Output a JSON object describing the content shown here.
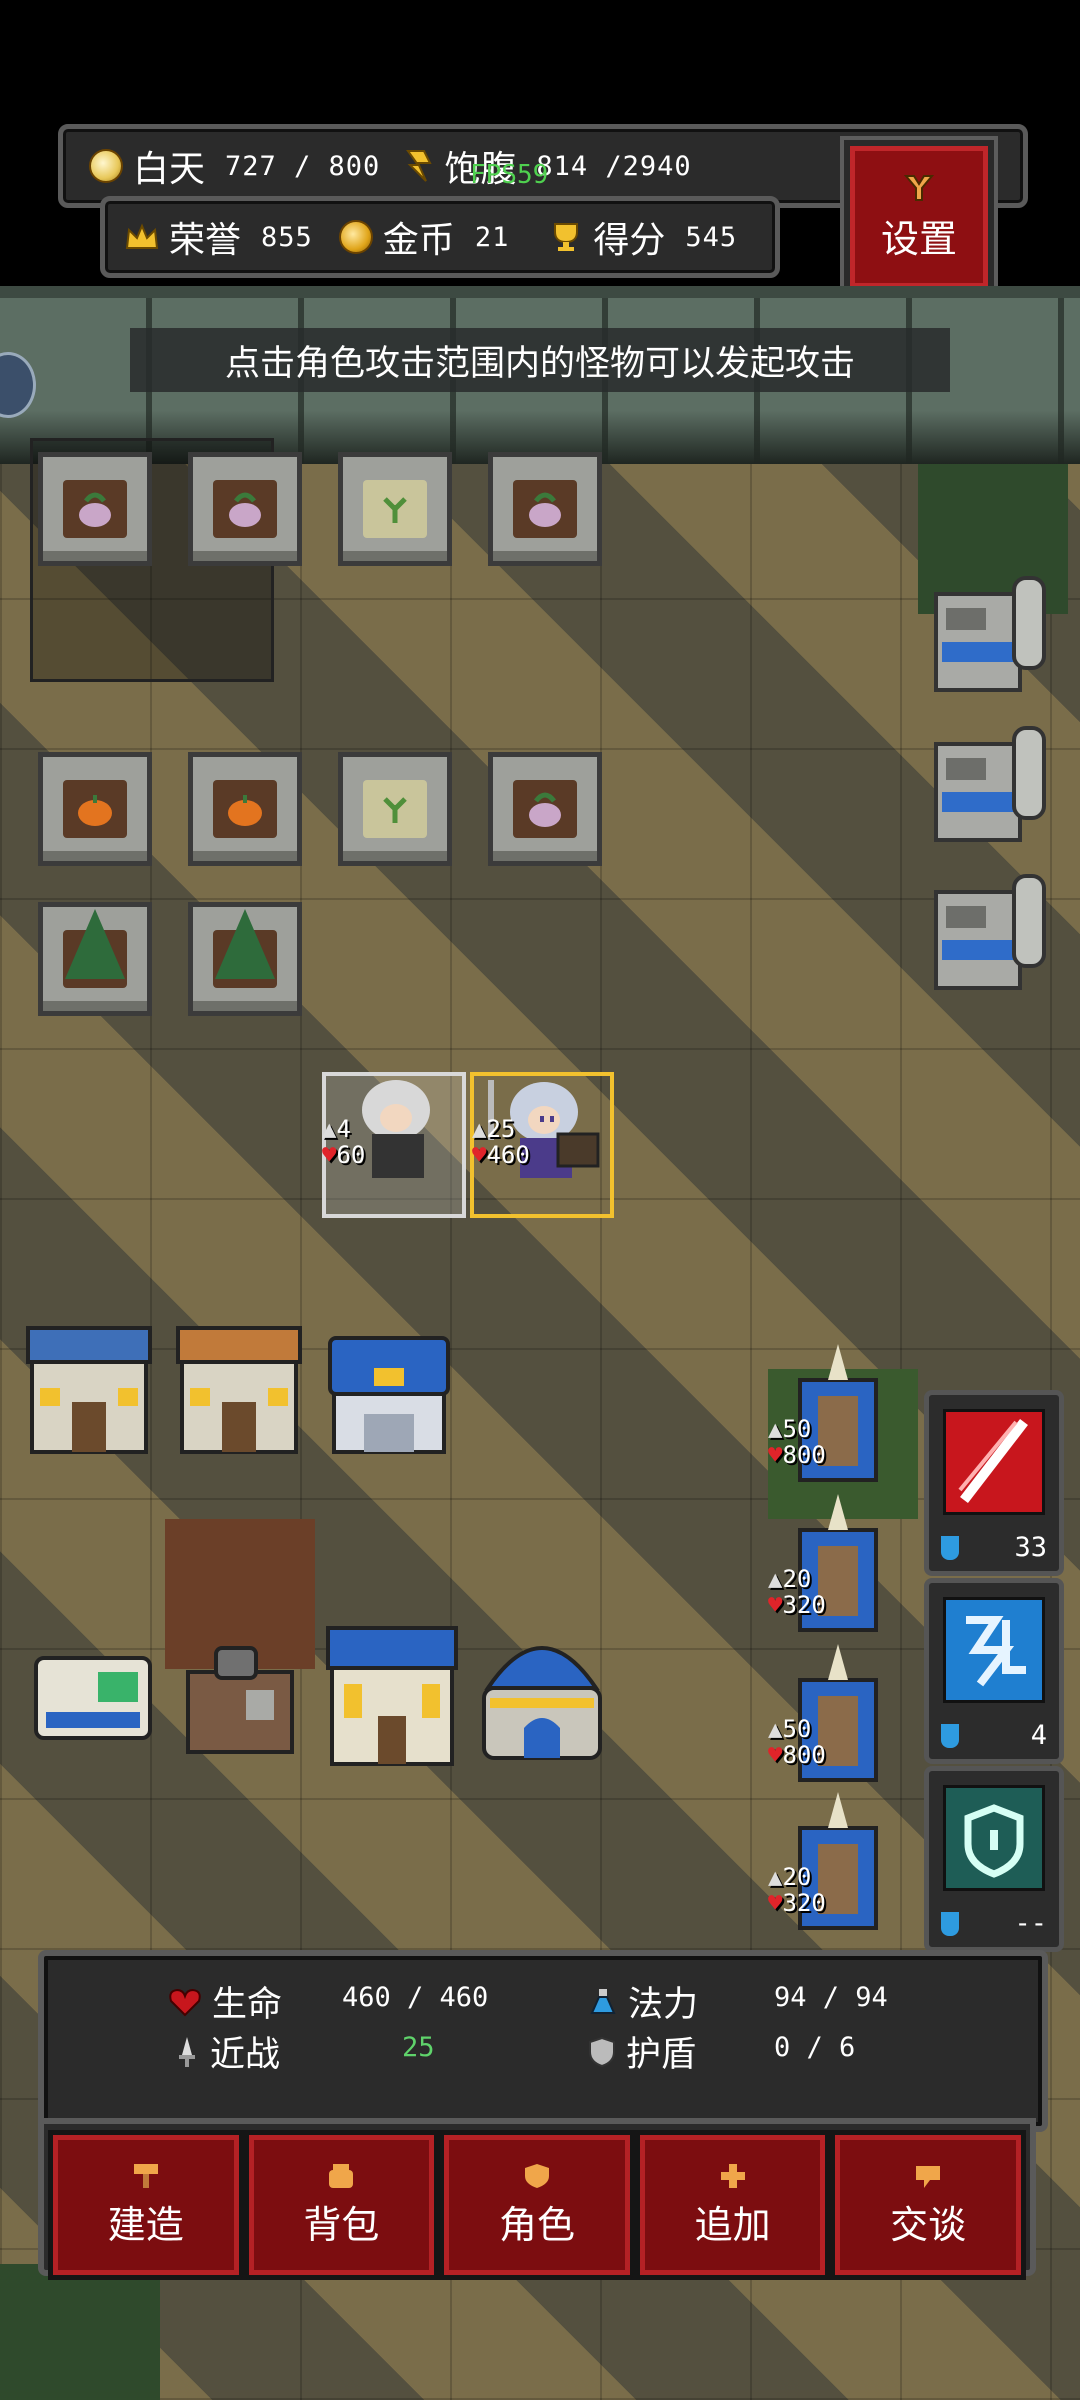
{
  "hud": {
    "day": {
      "label": "白天",
      "value": "727 / 800"
    },
    "satiety": {
      "label": "饱腹",
      "value": "814 /2940"
    },
    "fps": "FPS59",
    "honor": {
      "label": "荣誉",
      "value": "855"
    },
    "gold": {
      "label": "金币",
      "value": "21"
    },
    "score": {
      "label": "得分",
      "value": "545"
    },
    "settings_label": "设置"
  },
  "hint": "点击角色攻击范围内的怪物可以发起攻击",
  "units": {
    "npc_attack": "4",
    "npc_hp": "60",
    "hero_attack": "25",
    "hero_hp": "460",
    "turret1_atk": "50",
    "turret1_hp": "800",
    "turret2_atk": "20",
    "turret2_hp": "320",
    "turret3_atk": "50",
    "turret3_hp": "800",
    "turret4_atk": "20",
    "turret4_hp": "320"
  },
  "skills": [
    {
      "name": "crimson-slash-icon",
      "cost": "33",
      "color": "#c8161d"
    },
    {
      "name": "lightning-rune-icon",
      "cost": "4",
      "color": "#1f7fd0"
    },
    {
      "name": "shield-icon",
      "cost": "--",
      "color": "#1e5d56"
    }
  ],
  "stats": {
    "hp": {
      "label": "生命",
      "value": "460 / 460"
    },
    "mana": {
      "label": "法力",
      "value": "94 / 94"
    },
    "melee": {
      "label": "近战",
      "value": "25"
    },
    "shield": {
      "label": "护盾",
      "value": "0 / 6"
    }
  },
  "actions": [
    {
      "label": "建造"
    },
    {
      "label": "背包"
    },
    {
      "label": "角色"
    },
    {
      "label": "追加"
    },
    {
      "label": "交谈"
    }
  ],
  "colors": {
    "button_red": "#7c0d10",
    "accent_gold": "#f2c12e",
    "hp_red": "#e0242a",
    "mana_blue": "#2e9be0"
  }
}
